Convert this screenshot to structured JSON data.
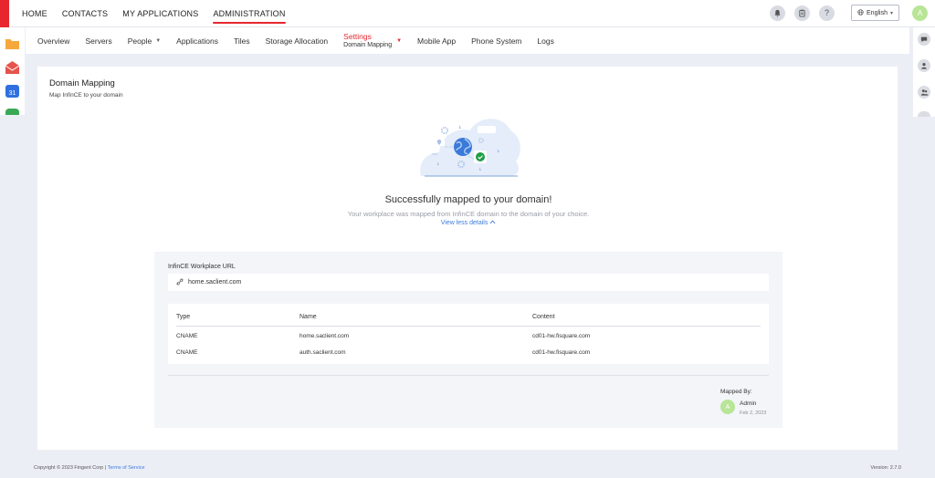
{
  "topnav": {
    "items": [
      {
        "label": "HOME"
      },
      {
        "label": "CONTACTS"
      },
      {
        "label": "MY APPLICATIONS"
      },
      {
        "label": "ADMINISTRATION",
        "active": true
      }
    ]
  },
  "topright": {
    "help_glyph": "?",
    "language": "English",
    "avatar_initial": "A"
  },
  "subnav": {
    "items": [
      {
        "label": "Overview"
      },
      {
        "label": "Servers"
      },
      {
        "label": "People"
      },
      {
        "label": "Applications"
      },
      {
        "label": "Tiles"
      },
      {
        "label": "Storage Allocation"
      },
      {
        "label": "Settings",
        "sublabel": "Domain Mapping"
      },
      {
        "label": "Mobile App"
      },
      {
        "label": "Phone System"
      },
      {
        "label": "Logs"
      }
    ]
  },
  "calendar_day": "31",
  "page": {
    "title": "Domain Mapping",
    "subtitle": "Map InfinCE to your domain"
  },
  "success": {
    "title": "Successfully mapped to your domain!",
    "description": "Your workplace was mapped from InfinCE domain to the domain of your choice.",
    "toggle_label": "View less details"
  },
  "details": {
    "workplace_label": "InfinCE Workplace URL",
    "workplace_url": "home.saclient.com",
    "columns": [
      "Type",
      "Name",
      "Content"
    ],
    "records": [
      {
        "type": "CNAME",
        "name": "home.saclient.com",
        "content": "cd01-hw.fisquare.com"
      },
      {
        "type": "CNAME",
        "name": "auth.saclient.com",
        "content": "cd01-hw.fisquare.com"
      }
    ],
    "mapped_by_label": "Mapped By:",
    "mapped_by_initial": "A",
    "mapped_by_name": "Admin",
    "mapped_by_date": "Feb 2, 2023"
  },
  "footer": {
    "copyright": "Copyright © 2023 Fingent Corp | ",
    "terms": "Terms of Service",
    "version": "Version: 2.7.0"
  },
  "colors": {
    "accent_red": "#e8262f",
    "link_blue": "#3d7bdc",
    "avatar_green": "#b8e596"
  },
  "icons": [
    "bell-icon",
    "clipboard-icon",
    "help-icon",
    "globe-icon",
    "chat-icon",
    "user-icon",
    "users-icon",
    "link-icon",
    "check-icon"
  ]
}
